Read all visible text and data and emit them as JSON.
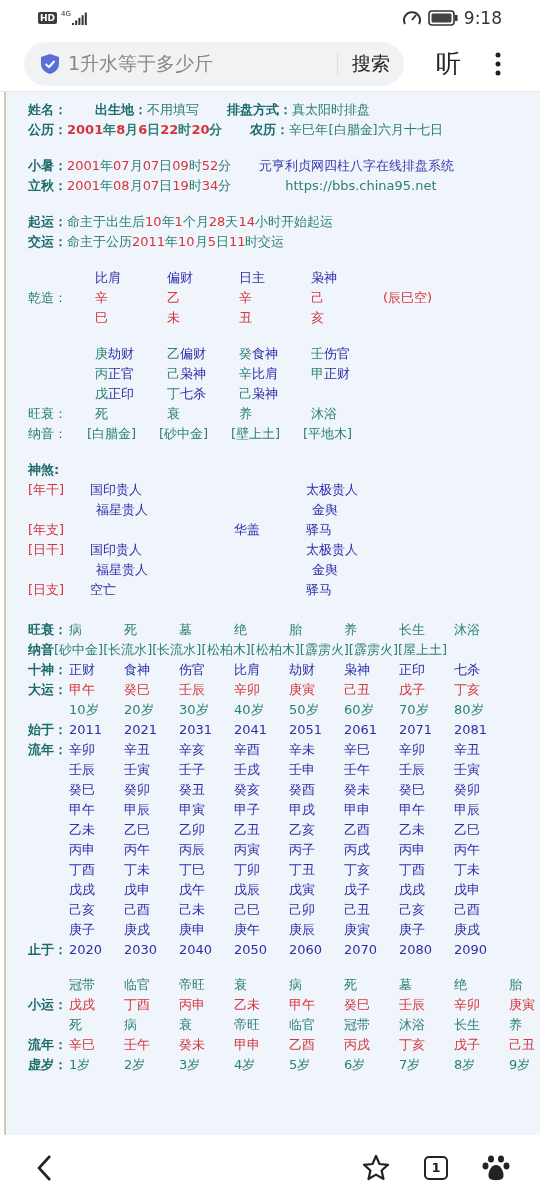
{
  "status_bar": {
    "badge": "HD",
    "network": "4G",
    "time": "9:18"
  },
  "browser": {
    "query": "1升水等于多少斤",
    "search_button": "搜索",
    "listen_button": "听"
  },
  "header_groups": [
    [
      [
        {
          "label": "姓名："
        },
        {
          "label": "出生地：",
          "value": [
            {
              "text": "不用填写",
              "kind": "plain"
            }
          ]
        },
        {
          "label": "排盘方式：",
          "value": [
            {
              "text": "真太阳时排盘",
              "kind": "plain"
            }
          ]
        }
      ],
      [
        {
          "label": "公历：",
          "bold": true,
          "value": [
            {
              "text": "2001",
              "kind": "hl"
            },
            {
              "text": "年",
              "kind": "plain"
            },
            {
              "text": "8",
              "kind": "hl"
            },
            {
              "text": "月",
              "kind": "plain"
            },
            {
              "text": "6",
              "kind": "hl"
            },
            {
              "text": "日",
              "kind": "plain"
            },
            {
              "text": "22",
              "kind": "hl"
            },
            {
              "text": "时",
              "kind": "plain"
            },
            {
              "text": "20",
              "kind": "hl"
            },
            {
              "text": "分",
              "kind": "plain"
            }
          ]
        },
        {
          "label": "农历：",
          "value": [
            {
              "text": "辛巳年[白腊金]六月十七日",
              "kind": "plain"
            }
          ]
        }
      ]
    ],
    [
      [
        {
          "label": "小暑：",
          "value": [
            {
              "text": "2001",
              "kind": "hl"
            },
            {
              "text": "年",
              "kind": "plain"
            },
            {
              "text": "07",
              "kind": "hl"
            },
            {
              "text": "月",
              "kind": "plain"
            },
            {
              "text": "07",
              "kind": "hl"
            },
            {
              "text": "日",
              "kind": "plain"
            },
            {
              "text": "09",
              "kind": "hl"
            },
            {
              "text": "时",
              "kind": "plain"
            },
            {
              "text": "52",
              "kind": "hl"
            },
            {
              "text": "分",
              "kind": "plain"
            }
          ]
        },
        {
          "value": [
            {
              "text": "元亨利贞网四柱八字在线排盘系统",
              "kind": "site"
            }
          ]
        }
      ],
      [
        {
          "label": "立秋：",
          "value": [
            {
              "text": "2001",
              "kind": "hl"
            },
            {
              "text": "年",
              "kind": "plain"
            },
            {
              "text": "08",
              "kind": "hl"
            },
            {
              "text": "月",
              "kind": "plain"
            },
            {
              "text": "07",
              "kind": "hl"
            },
            {
              "text": "日",
              "kind": "plain"
            },
            {
              "text": "19",
              "kind": "hl"
            },
            {
              "text": "时",
              "kind": "plain"
            },
            {
              "text": "34",
              "kind": "hl"
            },
            {
              "text": "分",
              "kind": "plain"
            }
          ]
        },
        {
          "value": [
            {
              "text": "https://bbs.china95.net",
              "kind": "link"
            }
          ]
        }
      ]
    ],
    [
      [
        {
          "label": "起运：",
          "value": [
            {
              "text": "命主于出生后",
              "kind": "plain"
            },
            {
              "text": "10",
              "kind": "hl"
            },
            {
              "text": "年",
              "kind": "plain"
            },
            {
              "text": "1",
              "kind": "hl"
            },
            {
              "text": "个月",
              "kind": "plain"
            },
            {
              "text": "28",
              "kind": "hl"
            },
            {
              "text": "天",
              "kind": "plain"
            },
            {
              "text": "14",
              "kind": "hl"
            },
            {
              "text": "小时开始起运",
              "kind": "plain"
            }
          ]
        }
      ],
      [
        {
          "label": "交运：",
          "value": [
            {
              "text": "命主于公历",
              "kind": "plain"
            },
            {
              "text": "2011",
              "kind": "hl"
            },
            {
              "text": "年",
              "kind": "plain"
            },
            {
              "text": "10",
              "kind": "hl"
            },
            {
              "text": "月",
              "kind": "plain"
            },
            {
              "text": "5",
              "kind": "hl"
            },
            {
              "text": "日",
              "kind": "plain"
            },
            {
              "text": "11",
              "kind": "hl"
            },
            {
              "text": "时交运",
              "kind": "plain"
            }
          ]
        }
      ]
    ]
  ],
  "pillars": {
    "label": "乾造：",
    "gods": [
      "比肩",
      "偏财",
      "日主",
      "枭神"
    ],
    "stems": [
      "辛",
      "乙",
      "辛",
      "己"
    ],
    "branches": [
      "巳",
      "未",
      "丑",
      "亥"
    ],
    "void": "(辰巳空)",
    "hidden": [
      [
        {
          "stem": "庚",
          "god": "劫财"
        },
        {
          "stem": "丙",
          "god": "正官"
        },
        {
          "stem": "戊",
          "god": "正印"
        }
      ],
      [
        {
          "stem": "乙",
          "god": "偏财"
        },
        {
          "stem": "己",
          "god": "枭神"
        },
        {
          "stem": "丁",
          "god": "七杀"
        }
      ],
      [
        {
          "stem": "癸",
          "god": "食神"
        },
        {
          "stem": "辛",
          "god": "比肩"
        },
        {
          "stem": "己",
          "god": "枭神"
        }
      ],
      [
        {
          "stem": "壬",
          "god": "伤官"
        },
        {
          "stem": "甲",
          "god": "正财"
        }
      ]
    ],
    "strength": {
      "label": "旺衰：",
      "values": [
        "死",
        "衰",
        "养",
        "沐浴"
      ]
    },
    "nayin": {
      "label": "纳音：",
      "values": [
        "[白腊金]",
        "[砂中金]",
        "[壁上土]",
        "[平地木]"
      ]
    }
  },
  "shensha": {
    "title": "神煞:",
    "rows": [
      {
        "tag": "[年干]",
        "cells": [
          "国印贵人",
          null,
          null,
          "太极贵人"
        ]
      },
      {
        "cells": [
          "福星贵人",
          null,
          null,
          "金舆"
        ]
      },
      {
        "tag": "[年支]",
        "cells": [
          null,
          null,
          "华盖",
          "驿马"
        ]
      },
      {
        "tag": "[日干]",
        "cells": [
          "国印贵人",
          null,
          null,
          "太极贵人"
        ]
      },
      {
        "cells": [
          "福星贵人",
          null,
          null,
          "金舆"
        ]
      },
      {
        "tag": "[日支]",
        "cells": [
          "空亡",
          null,
          null,
          "驿马"
        ]
      }
    ]
  },
  "fortune_table": [
    {
      "kind": "plain",
      "label": "旺衰：",
      "cells": [
        "病",
        "死",
        "墓",
        "绝",
        "胎",
        "养",
        "长生",
        "沐浴"
      ]
    },
    {
      "kind": "line",
      "label": "纳音",
      "text": "[砂中金][长流水][长流水][松柏木][松柏木][霹雳火][霹雳火][屋上土]"
    },
    {
      "kind": "term",
      "label": "十神：",
      "cells": [
        "正财",
        "食神",
        "伤官",
        "比肩",
        "劫财",
        "枭神",
        "正印",
        "七杀"
      ]
    },
    {
      "kind": "accent",
      "label": "大运：",
      "cells": [
        "甲午",
        "癸巳",
        "壬辰",
        "辛卯",
        "庚寅",
        "己丑",
        "戊子",
        "丁亥"
      ]
    },
    {
      "kind": "plain",
      "cells": [
        "10岁",
        "20岁",
        "30岁",
        "40岁",
        "50岁",
        "60岁",
        "70岁",
        "80岁"
      ]
    },
    {
      "kind": "term",
      "label": "始于：",
      "cells": [
        "2011",
        "2021",
        "2031",
        "2041",
        "2051",
        "2061",
        "2071",
        "2081"
      ]
    },
    {
      "kind": "term",
      "label": "流年：",
      "cells": [
        "辛卯",
        "辛丑",
        "辛亥",
        "辛酉",
        "辛未",
        "辛巳",
        "辛卯",
        "辛丑"
      ]
    },
    {
      "kind": "term",
      "cells": [
        "壬辰",
        "壬寅",
        "壬子",
        "壬戌",
        "壬申",
        "壬午",
        "壬辰",
        "壬寅"
      ]
    },
    {
      "kind": "term",
      "cells": [
        "癸巳",
        "癸卯",
        "癸丑",
        "癸亥",
        "癸酉",
        "癸未",
        "癸巳",
        "癸卯"
      ]
    },
    {
      "kind": "term",
      "cells": [
        "甲午",
        "甲辰",
        "甲寅",
        "甲子",
        "甲戌",
        "甲申",
        "甲午",
        "甲辰"
      ]
    },
    {
      "kind": "term",
      "cells": [
        "乙未",
        "乙巳",
        "乙卯",
        "乙丑",
        "乙亥",
        "乙酉",
        "乙未",
        "乙巳"
      ]
    },
    {
      "kind": "term",
      "cells": [
        "丙申",
        "丙午",
        "丙辰",
        "丙寅",
        "丙子",
        "丙戌",
        "丙申",
        "丙午"
      ]
    },
    {
      "kind": "term",
      "cells": [
        "丁酉",
        "丁未",
        "丁巳",
        "丁卯",
        "丁丑",
        "丁亥",
        "丁酉",
        "丁未"
      ]
    },
    {
      "kind": "term",
      "cells": [
        "戊戌",
        "戊申",
        "戊午",
        "戊辰",
        "戊寅",
        "戊子",
        "戊戌",
        "戊申"
      ]
    },
    {
      "kind": "term",
      "cells": [
        "己亥",
        "己酉",
        "己未",
        "己巳",
        "己卯",
        "己丑",
        "己亥",
        "己酉"
      ]
    },
    {
      "kind": "term",
      "cells": [
        "庚子",
        "庚戌",
        "庚申",
        "庚午",
        "庚辰",
        "庚寅",
        "庚子",
        "庚戌"
      ]
    },
    {
      "kind": "term",
      "label": "止于：",
      "cells": [
        "2020",
        "2030",
        "2040",
        "2050",
        "2060",
        "2070",
        "2080",
        "2090"
      ]
    },
    {
      "kind": "gap"
    },
    {
      "kind": "plain",
      "cells": [
        "冠带",
        "临官",
        "帝旺",
        "衰",
        "病",
        "死",
        "墓",
        "绝",
        "胎"
      ]
    },
    {
      "kind": "accent",
      "label": "小运：",
      "cells": [
        "戊戌",
        "丁酉",
        "丙申",
        "乙未",
        "甲午",
        "癸巳",
        "壬辰",
        "辛卯",
        "庚寅"
      ]
    },
    {
      "kind": "plain",
      "cells": [
        "死",
        "病",
        "衰",
        "帝旺",
        "临官",
        "冠带",
        "沐浴",
        "长生",
        "养"
      ]
    },
    {
      "kind": "accent",
      "label": "流年：",
      "cells": [
        "辛巳",
        "壬午",
        "癸未",
        "甲申",
        "乙酉",
        "丙戌",
        "丁亥",
        "戊子",
        "己丑"
      ]
    },
    {
      "kind": "plain",
      "label": "虚岁：",
      "cells": [
        "1岁",
        "2岁",
        "3岁",
        "4岁",
        "5岁",
        "6岁",
        "7岁",
        "8岁",
        "9岁"
      ]
    }
  ],
  "bottom_nav": {
    "tab_count": "1"
  }
}
